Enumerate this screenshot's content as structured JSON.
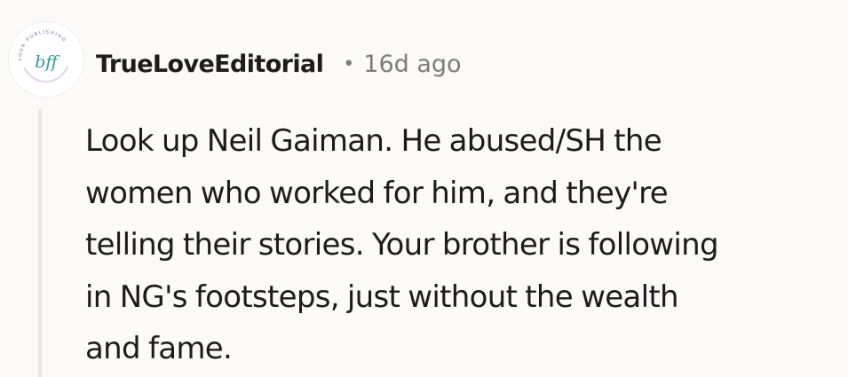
{
  "comment": {
    "avatar": {
      "initials": "bff",
      "ring_text": "YOUR PUBLISHING",
      "accent_color": "#2f9aa0",
      "ring_color": "#d9c7e3"
    },
    "author": "TrueLoveEditorial",
    "separator": "•",
    "timestamp": "16d ago",
    "body_lines": [
      "Look up Neil Gaiman. He abused/SH the",
      "women who worked for him, and they're",
      "telling their stories. Your brother is following",
      "in NG's footsteps, just without the wealth",
      "and fame."
    ]
  }
}
